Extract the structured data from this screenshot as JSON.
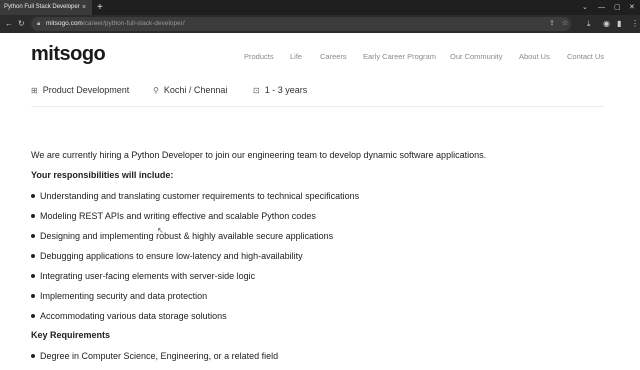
{
  "browser": {
    "tab_title": "Python Full Stack Developer",
    "tab_close": "×",
    "new_tab": "+",
    "url_domain": "mitsogo.com",
    "url_path": "/career/python-full-stack-developer/",
    "icons": [
      "back-icon",
      "forward-icon",
      "reload-icon",
      "lock-icon",
      "share-icon",
      "star-icon",
      "download-icon",
      "sidebar-icon",
      "menu-icon",
      "minimize-icon",
      "maximize-icon",
      "close-icon"
    ]
  },
  "site": {
    "logo": "mitsogo",
    "nav": [
      "Products",
      "Life",
      "Careers",
      "Early Career Program",
      "Our Community",
      "About Us",
      "Contact Us"
    ]
  },
  "job_meta": {
    "department": "Product Development",
    "location": "Kochi / Chennai",
    "experience": "1 - 3 years"
  },
  "content": {
    "intro": "We are currently hiring a Python Developer to join our engineering team to develop dynamic software applications.",
    "responsibilities_heading": "Your responsibilities will include:",
    "responsibilities": [
      "Understanding and translating customer requirements to technical specifications",
      "Modeling REST APIs and writing effective and scalable Python codes",
      "Designing and implementing robust & highly available secure applications",
      "Debugging applications to ensure low-latency and high-availability",
      "Integrating user-facing elements with server-side logic",
      "Implementing security and data protection",
      "Accommodating various data storage solutions"
    ],
    "requirements_heading": "Key Requirements",
    "requirements": [
      "Degree in Computer Science, Engineering, or a related field"
    ]
  }
}
